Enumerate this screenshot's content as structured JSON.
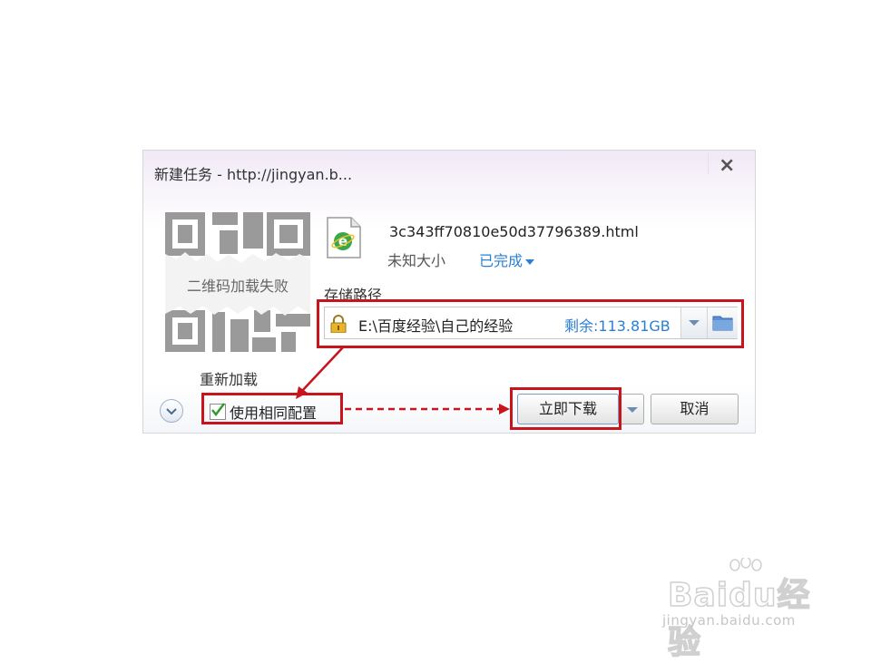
{
  "dialog": {
    "title": "新建任务 - http://jingyan.b...",
    "close_label": "×"
  },
  "qr": {
    "failed_text": "二维码加载失败",
    "reload_label": "重新加载"
  },
  "file": {
    "icon": "ie-html-file-icon",
    "name": "3c343ff70810e50d37796389.html",
    "size": "未知大小",
    "status": "已完成"
  },
  "storage": {
    "label": "存储路径",
    "path": "E:\\百度经验\\自己的经验",
    "free_space": "剩余:113.81GB"
  },
  "footer": {
    "same_config_label": "使用相同配置",
    "same_config_checked": true,
    "download_label": "立即下载",
    "cancel_label": "取消"
  },
  "watermark": {
    "brand": "Baidu经验",
    "url": "jingyan.baidu.com"
  },
  "colors": {
    "highlight": "#c8141c",
    "link": "#2b7fd3"
  }
}
